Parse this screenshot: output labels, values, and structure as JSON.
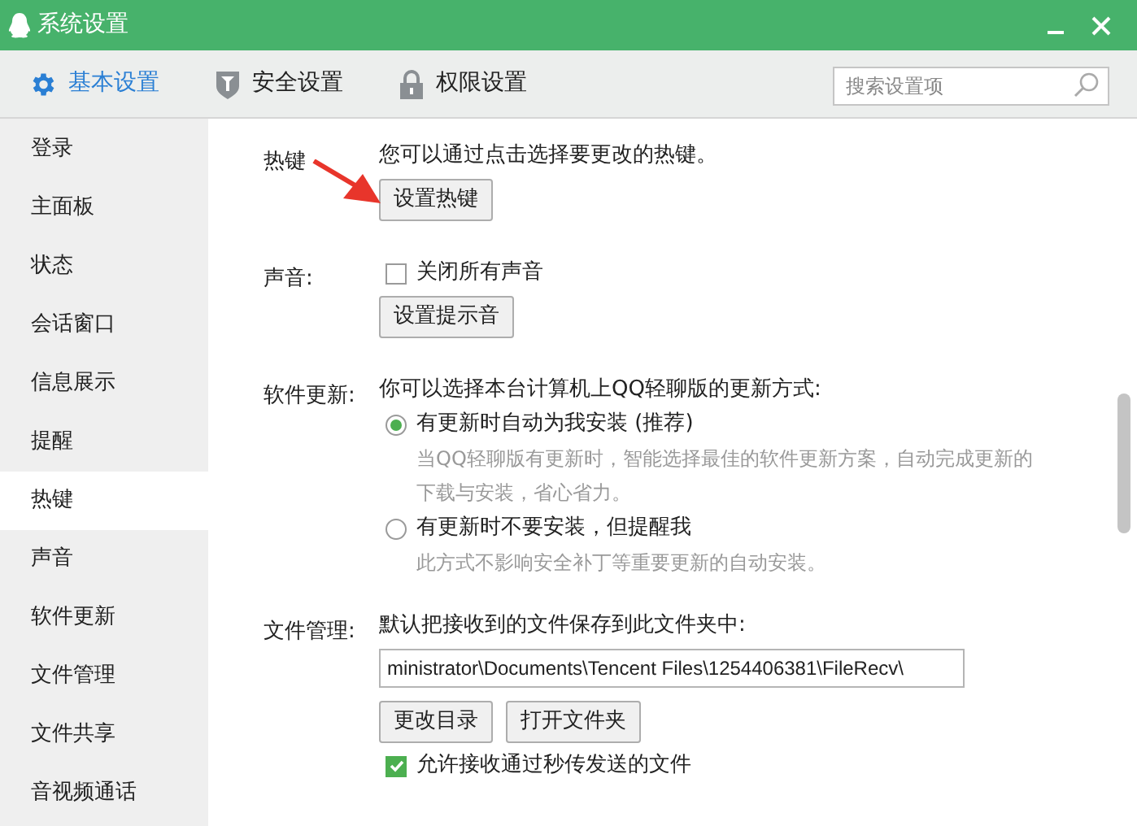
{
  "window": {
    "title": "系统设置"
  },
  "tabs": [
    {
      "label": "基本设置",
      "selected": true,
      "kind": "gear"
    },
    {
      "label": "安全设置",
      "selected": false,
      "kind": "shield"
    },
    {
      "label": "权限设置",
      "selected": false,
      "kind": "lock"
    }
  ],
  "search": {
    "placeholder": "搜索设置项"
  },
  "sidebar": {
    "items": [
      {
        "label": "登录",
        "selected": false
      },
      {
        "label": "主面板",
        "selected": false
      },
      {
        "label": "状态",
        "selected": false
      },
      {
        "label": "会话窗口",
        "selected": false
      },
      {
        "label": "信息展示",
        "selected": false
      },
      {
        "label": "提醒",
        "selected": false
      },
      {
        "label": "热键",
        "selected": true
      },
      {
        "label": "声音",
        "selected": false
      },
      {
        "label": "软件更新",
        "selected": false
      },
      {
        "label": "文件管理",
        "selected": false
      },
      {
        "label": "文件共享",
        "selected": false
      },
      {
        "label": "音视频通话",
        "selected": false
      }
    ]
  },
  "sections": [
    {
      "label": "热键",
      "items": [
        {
          "kind": "text",
          "text": "您可以通过点击选择要更改的热键。"
        },
        {
          "kind": "buttons",
          "buttons": [
            "设置热键"
          ]
        }
      ]
    },
    {
      "label": "声音:",
      "items": [
        {
          "kind": "checkbox",
          "text": "关闭所有声音",
          "checked": false
        },
        {
          "kind": "buttons",
          "buttons": [
            "设置提示音"
          ]
        }
      ]
    },
    {
      "label": "软件更新:",
      "items": [
        {
          "kind": "text",
          "text": "你可以选择本台计算机上QQ轻聊版的更新方式:"
        },
        {
          "kind": "radio",
          "text": "有更新时自动为我安装 (推荐)",
          "selected": true,
          "note": "当QQ轻聊版有更新时，智能选择最佳的软件更新方案，自动完成更新的下载与安装，省心省力。"
        },
        {
          "kind": "radio",
          "text": "有更新时不要安装，但提醒我",
          "selected": false,
          "note": "此方式不影响安全补丁等重要更新的自动安装。"
        }
      ]
    },
    {
      "label": "文件管理:",
      "items": [
        {
          "kind": "text",
          "text": "默认把接收到的文件保存到此文件夹中:"
        },
        {
          "kind": "field",
          "value": "ministrator\\Documents\\Tencent Files\\1254406381\\FileRecv\\"
        },
        {
          "kind": "buttons",
          "buttons": [
            "更改目录",
            "打开文件夹"
          ]
        },
        {
          "kind": "checkbox",
          "text": "允许接收通过秒传发送的文件",
          "checked": true
        }
      ]
    }
  ]
}
